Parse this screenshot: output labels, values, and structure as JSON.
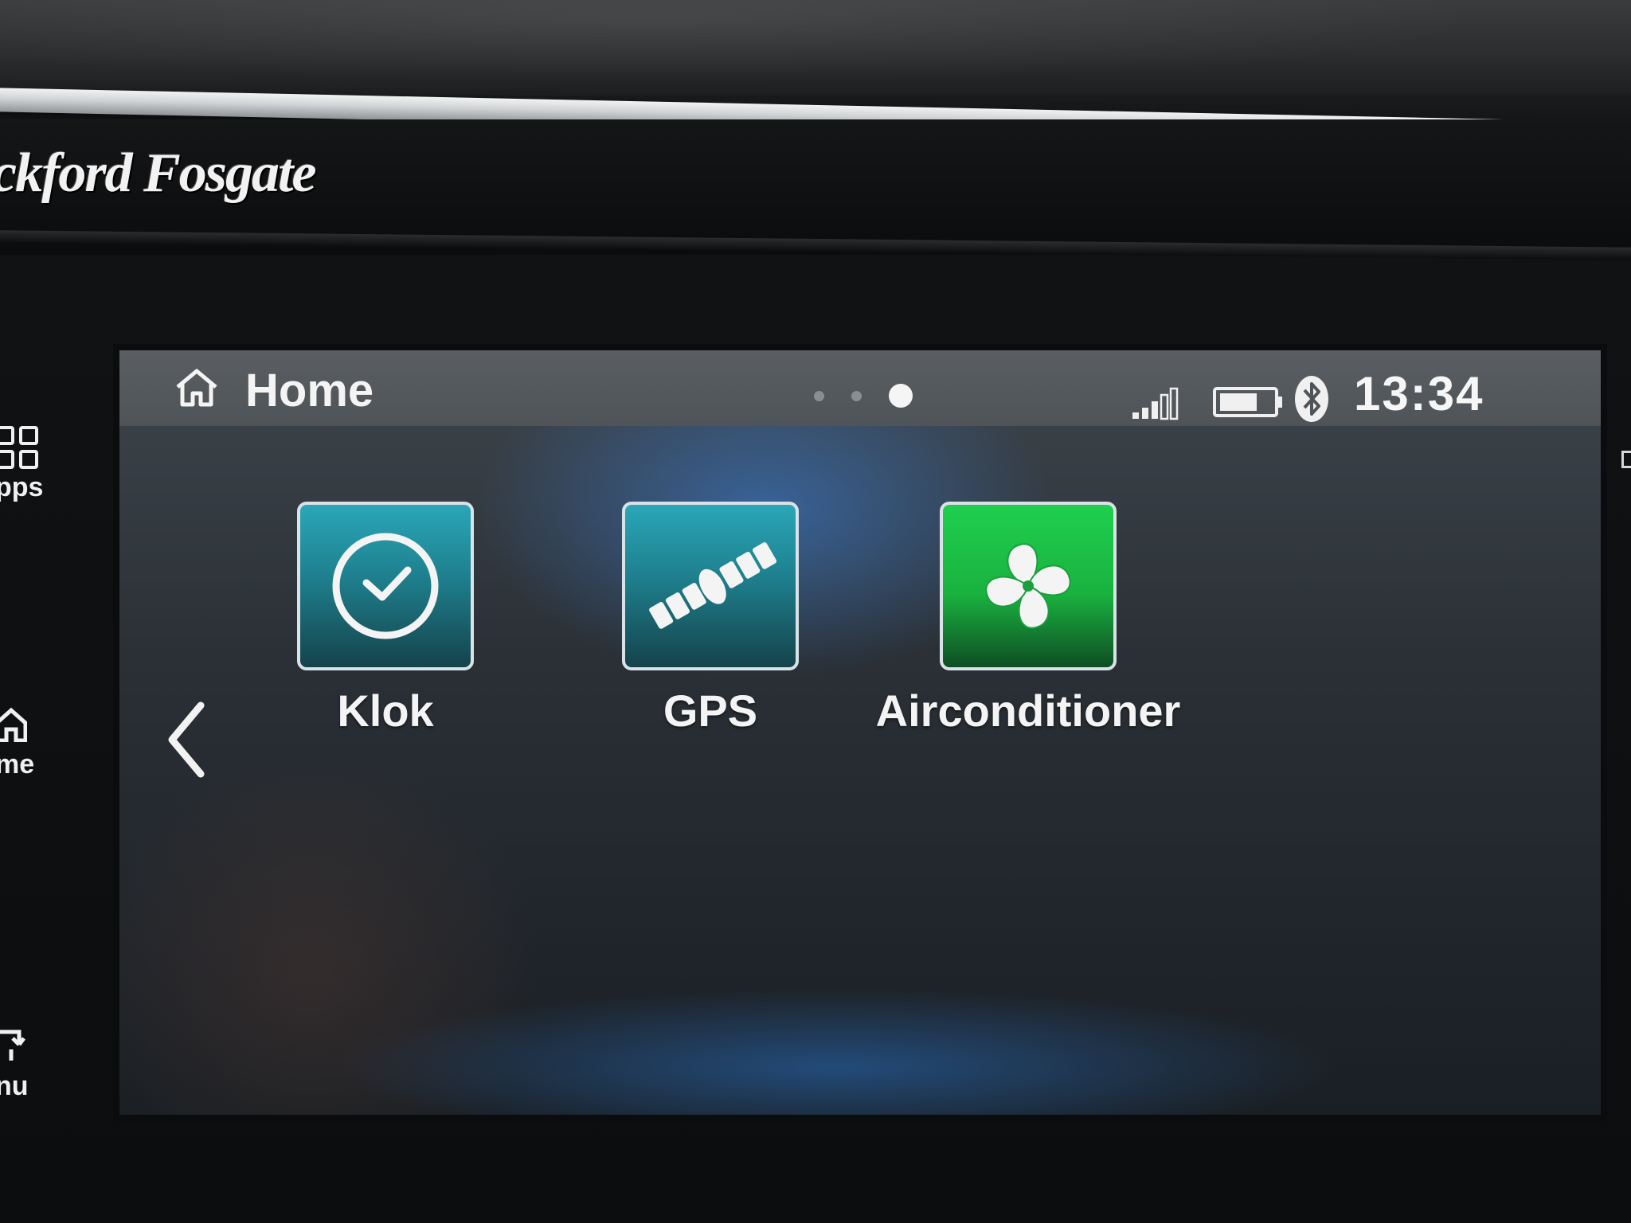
{
  "bezel": {
    "brand": "ckford Fosgate",
    "side_buttons": {
      "apps_label": "pps",
      "home_label": "me",
      "menu_label": "nu"
    }
  },
  "status_bar": {
    "title": "Home",
    "page_count": 3,
    "active_page": 3,
    "signal_icon": "signal-bars-icon",
    "battery_icon": "battery-icon",
    "bluetooth_icon": "bluetooth-icon",
    "time": "13:34"
  },
  "apps": [
    {
      "label": "Klok",
      "icon": "clock-icon",
      "tile_color": "#1e8d9c"
    },
    {
      "label": "GPS",
      "icon": "satellite-icon",
      "tile_color": "#1e8d9c"
    },
    {
      "label": "Airconditioner",
      "icon": "fan-icon",
      "tile_color": "#1fc64a"
    }
  ],
  "navigation": {
    "back_icon": "chevron-left-icon"
  }
}
